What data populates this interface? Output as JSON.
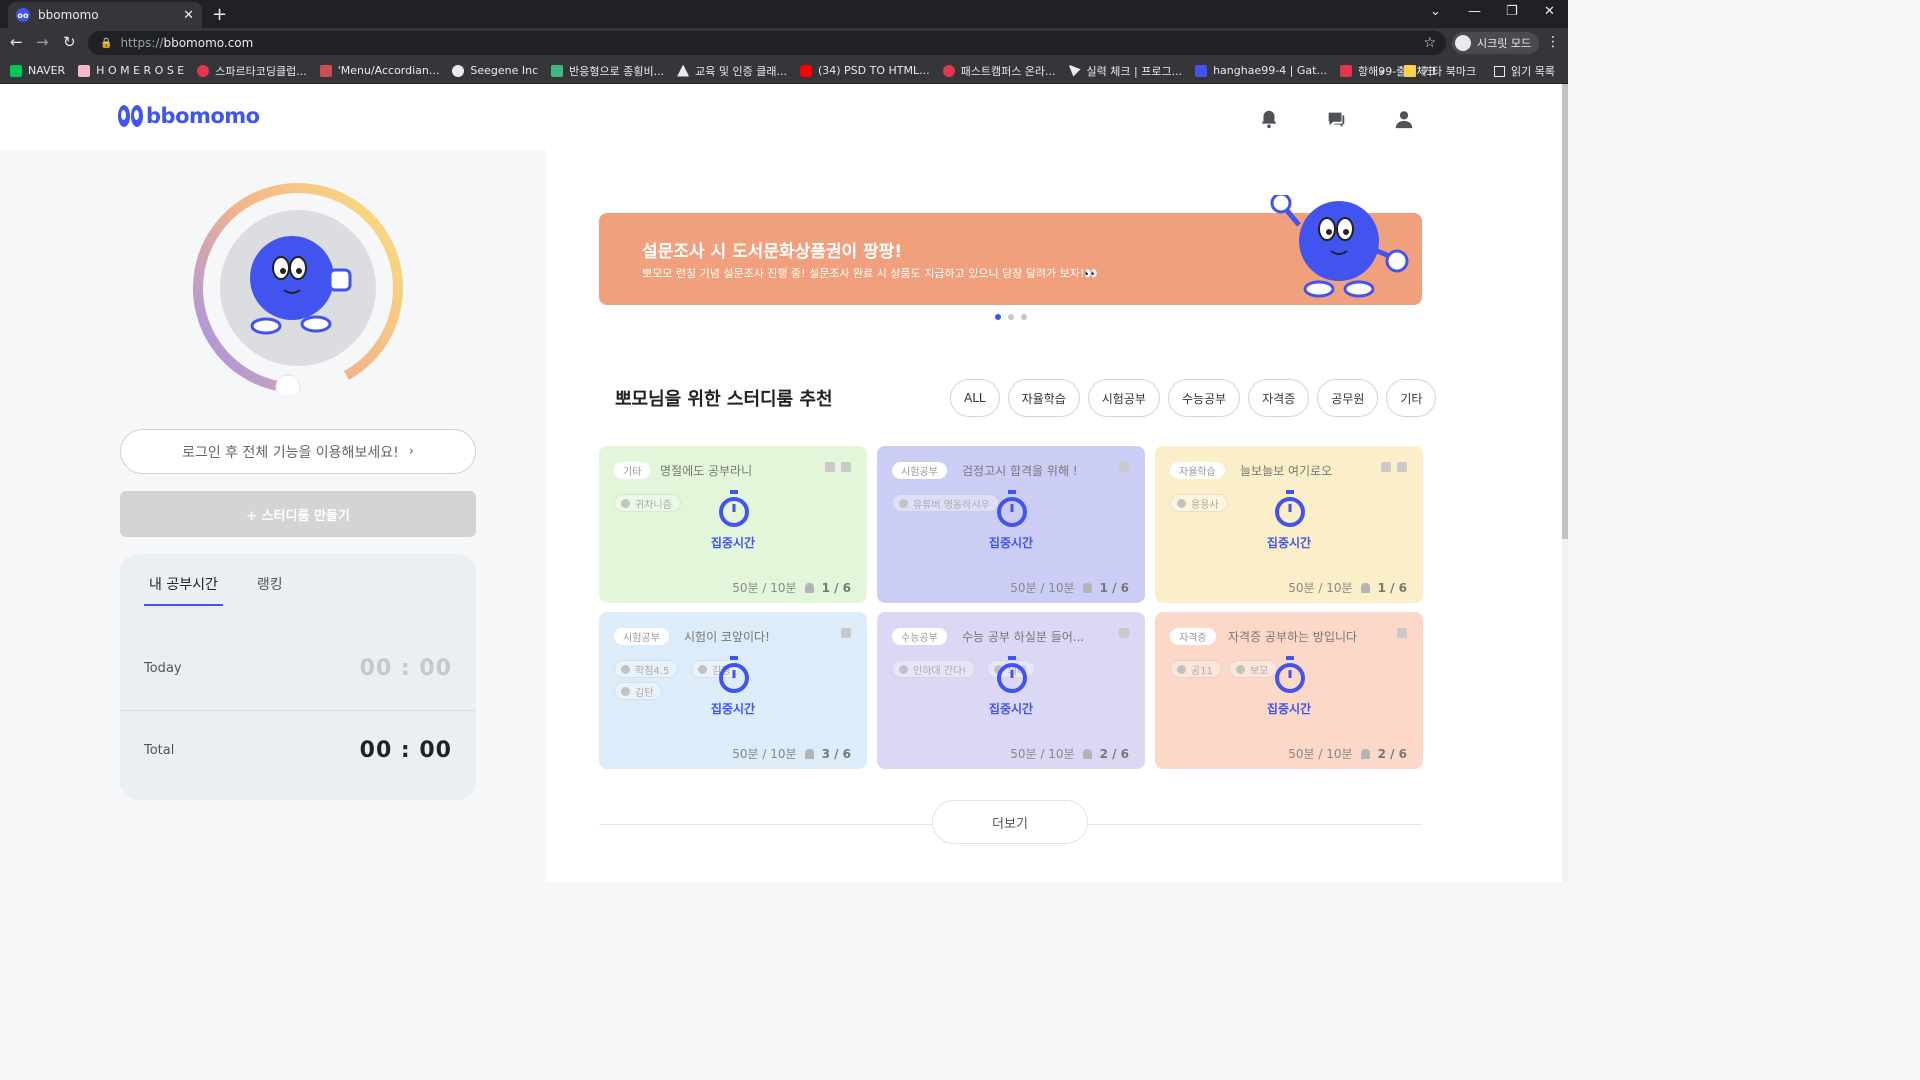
{
  "browser": {
    "tab_title": "bbomomo",
    "url_scheme": "https://",
    "url_host": "bbomomo.com",
    "incognito_label": "시크릿 모드",
    "bookmarks": [
      {
        "label": "NAVER",
        "color": "#03c75a"
      },
      {
        "label": "H O M E R O S E",
        "color": "#f3b8c9"
      },
      {
        "label": "스파르타코딩클럽...",
        "color": "#e8344e"
      },
      {
        "label": "'Menu/Accordian...",
        "color": "#c94f4f"
      },
      {
        "label": "Seegene Inc",
        "color": "#e8eaed"
      },
      {
        "label": "반응형으로 종횡비...",
        "color": "#41b883"
      },
      {
        "label": "교육 및 인증 클래...",
        "color": "#e8eaed"
      },
      {
        "label": "(34) PSD TO HTML...",
        "color": "#ff0000"
      },
      {
        "label": "패스트캠퍼스 온라...",
        "color": "#e8344e"
      },
      {
        "label": "실력 체크 | 프로그...",
        "color": "#e8eaed"
      },
      {
        "label": "hanghae99-4 | Gat...",
        "color": "#4254f0"
      },
      {
        "label": "항해99-출석체크",
        "color": "#e8344e"
      }
    ],
    "bookmarks_overflow": "»",
    "other_bookmarks": "기타 북마크",
    "reading_list": "읽기 목록"
  },
  "header": {
    "logo_text": "bbomomo",
    "accent": "#4254f0"
  },
  "left": {
    "login_prompt": "로그인 후 전체 기능을 이용해보세요!",
    "login_arrow": "›",
    "create_room": "+ 스터디룸 만들기",
    "tabs": [
      "내 공부시간",
      "랭킹"
    ],
    "today_label": "Today",
    "today_value": "00 : 00",
    "total_label": "Total",
    "total_value": "00 : 00"
  },
  "banner": {
    "title": "설문조사 시 도서문화상품권이 팡팡!",
    "subtitle": "뽀모모 런칭 기념 설문조사 진행 중! 설문조사 완료 시 상품도 지급하고 있으니 당장 달려가 보자!👀",
    "color": "#f1a07e"
  },
  "recommend": {
    "title": "뽀모님을 위한 스터디룸 추천",
    "filters": [
      "ALL",
      "자율학습",
      "시험공부",
      "수능공부",
      "자격증",
      "공무원",
      "기타"
    ]
  },
  "cards": [
    {
      "category": "기타",
      "title": "명절에도 공부라니",
      "tags": [
        "귀차니즘"
      ],
      "focus": "집중시간",
      "time": "50분 / 10분",
      "people": "1 / 6",
      "bg": "#e3f6da",
      "locked": true
    },
    {
      "category": "시험공부",
      "title": "검정고시 합격을 위해 !",
      "tags": [
        "유튜버 영동하시우"
      ],
      "focus": "집중시간",
      "time": "50분 / 10분",
      "people": "1 / 6",
      "bg": "#cbcdf4",
      "locked": false
    },
    {
      "category": "자율학습",
      "title": "늘보늘보 여기로오",
      "tags": [
        "용용사"
      ],
      "focus": "집중시간",
      "time": "50분 / 10분",
      "people": "1 / 6",
      "bg": "#fbefc9",
      "locked": true
    },
    {
      "category": "시험공부",
      "title": "시험이 코앞이다!",
      "tags": [
        "학점4.5",
        "김경",
        "김탄"
      ],
      "focus": "집중시간",
      "time": "50분 / 10분",
      "people": "3 / 6",
      "bg": "#dcecf8",
      "locked": false
    },
    {
      "category": "수능공부",
      "title": "수능 공부 하실분 들어...",
      "tags": [
        "인하대 간다!",
        "의대"
      ],
      "focus": "집중시간",
      "time": "50분 / 10분",
      "people": "2 / 6",
      "bg": "#dad8f5",
      "locked": false
    },
    {
      "category": "자격증",
      "title": "자격증 공부하는 방입니다",
      "tags": [
        "공11",
        "보모"
      ],
      "focus": "집중시간",
      "time": "50분 / 10분",
      "people": "2 / 6",
      "bg": "#fbd8c8",
      "locked": false
    }
  ],
  "more_button": "더보기"
}
